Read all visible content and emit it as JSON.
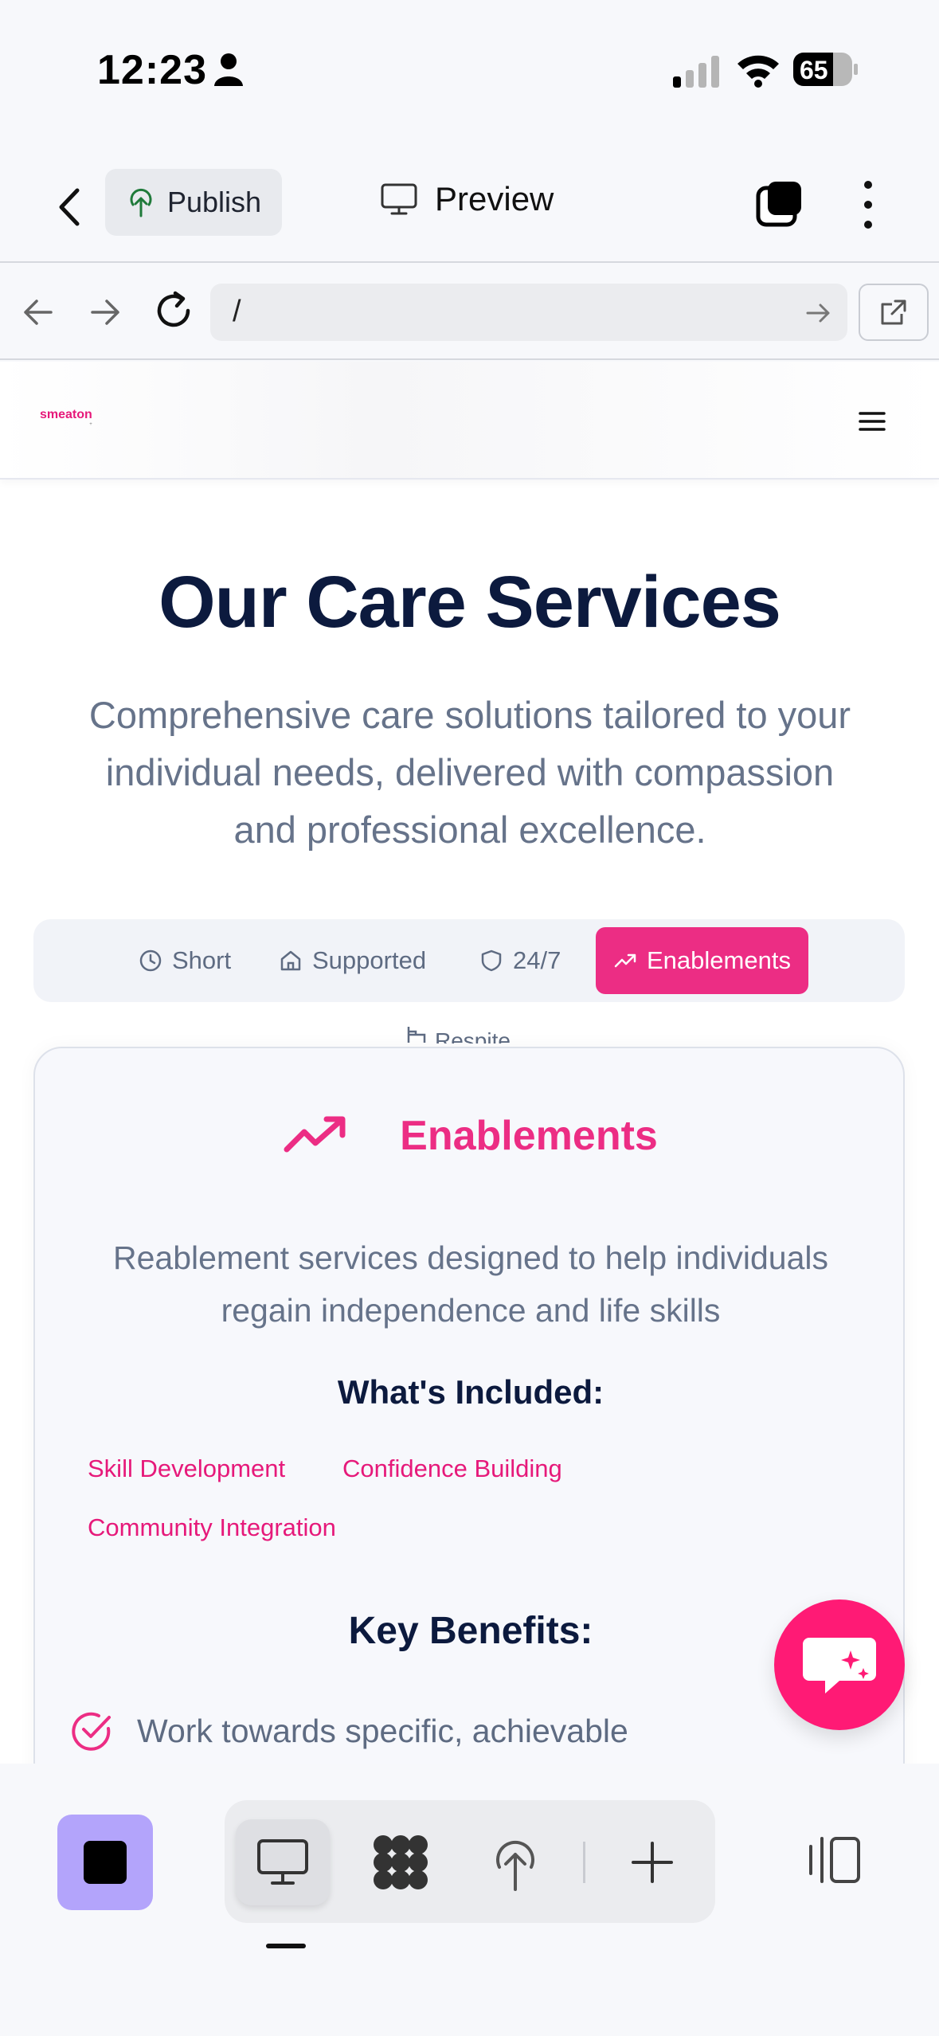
{
  "status_bar": {
    "time": "12:23",
    "battery": "65"
  },
  "toolbar": {
    "publish_label": "Publish",
    "preview_label": "Preview"
  },
  "browser": {
    "url": "/"
  },
  "site": {
    "logo": "smeaton",
    "hero_title": "Our Care Services",
    "hero_subtitle": "Comprehensive care solutions tailored to your individual needs, delivered with compassion and professional excellence.",
    "tabs": [
      {
        "label": "Short",
        "icon": "clock-icon"
      },
      {
        "label": "Supported",
        "icon": "home-icon"
      },
      {
        "label": "24/7",
        "icon": "shield-icon"
      },
      {
        "label": "Enablements",
        "icon": "trending-up-icon",
        "active": true
      }
    ],
    "overflow_tab": "Respite",
    "card": {
      "title": "Enablements",
      "description": "Reablement services designed to help individuals regain independence and life skills",
      "included_heading": "What's Included:",
      "included": [
        "Skill Development",
        "Confidence Building",
        "Community Integration"
      ],
      "benefits_heading": "Key Benefits:",
      "benefits": [
        "Work towards specific, achievable"
      ]
    }
  },
  "colors": {
    "accent": "#ec2d84",
    "fab": "#ff1a75",
    "stop_button": "#b3a4fb",
    "heading": "#0c1a3e"
  }
}
